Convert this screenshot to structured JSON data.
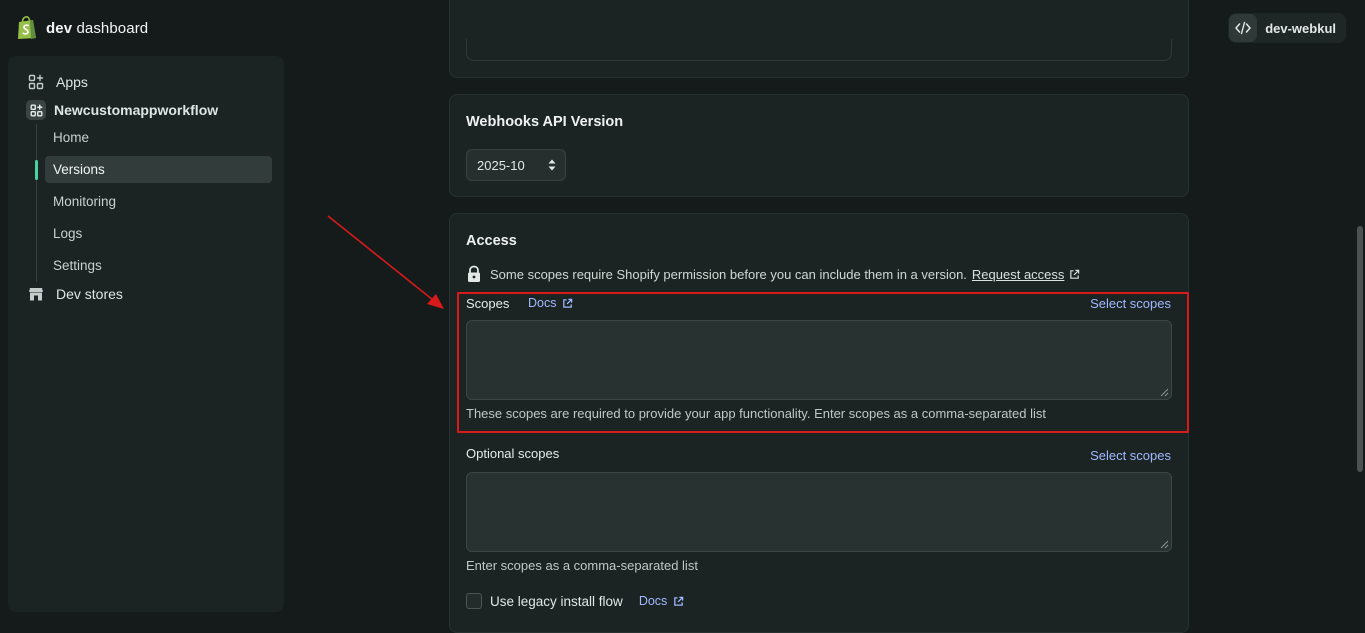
{
  "header": {
    "brand_bold": "dev",
    "brand_rest": "dashboard",
    "org_name": "dev-webkul"
  },
  "sidebar": {
    "apps_label": "Apps",
    "app_name": "Newcustomappworkflow",
    "sub_items": [
      {
        "label": "Home",
        "active": false
      },
      {
        "label": "Versions",
        "active": true
      },
      {
        "label": "Monitoring",
        "active": false
      },
      {
        "label": "Logs",
        "active": false
      },
      {
        "label": "Settings",
        "active": false
      }
    ],
    "dev_stores_label": "Dev stores"
  },
  "webhooks": {
    "title": "Webhooks API Version",
    "selected_version": "2025-10"
  },
  "access": {
    "title": "Access",
    "permission_notice": "Some scopes require Shopify permission before you can include them in a version.",
    "request_access_label": "Request access",
    "scopes": {
      "label": "Scopes",
      "docs_label": "Docs",
      "select_label": "Select scopes",
      "value": "",
      "help": "These scopes are required to provide your app functionality. Enter scopes as a comma-separated list"
    },
    "optional_scopes": {
      "label": "Optional scopes",
      "select_label": "Select scopes",
      "value": "",
      "help": "Enter scopes as a comma-separated list"
    },
    "legacy_install": {
      "label": "Use legacy install flow",
      "checked": false,
      "docs_label": "Docs"
    }
  },
  "colors": {
    "background": "#151b1a",
    "card": "#1c2423",
    "link": "#9fb9ff",
    "active_indicator": "#4bd1a0",
    "annotation_red": "#d81a1a",
    "shopify_green": "#95bf47"
  },
  "icons": {
    "logo": "shopify-bag-icon",
    "org": "code-brackets-icon",
    "apps": "apps-grid-icon",
    "app": "app-grid-icon",
    "dev_stores": "store-icon",
    "lock": "lock-icon",
    "external": "external-link-icon",
    "select_caret": "up-down-caret-icon"
  }
}
